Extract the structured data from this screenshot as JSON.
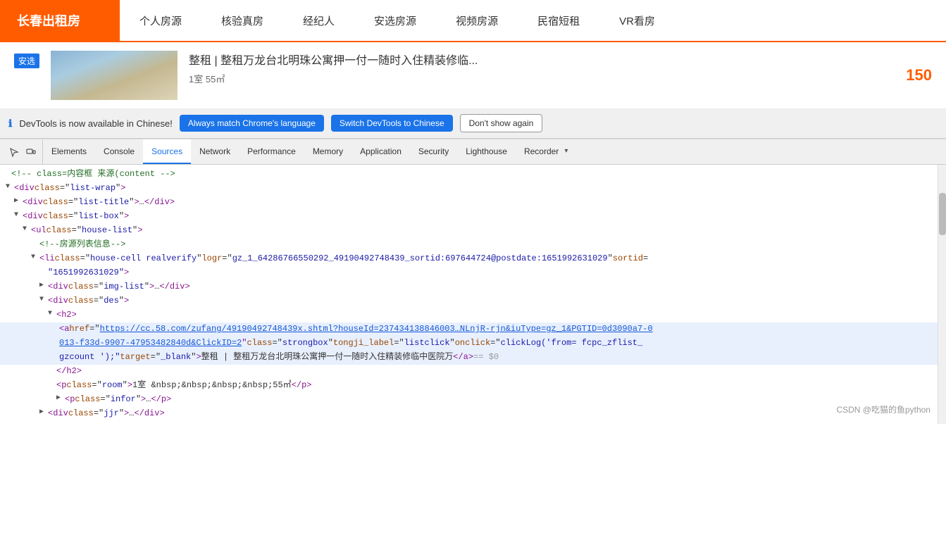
{
  "site": {
    "logo": "长春出租房",
    "nav": [
      "个人房源",
      "核验真房",
      "经纪人",
      "安选房源",
      "视频房源",
      "民宿短租",
      "VR看房"
    ]
  },
  "listing": {
    "badge": "安选",
    "title": "整租 | 整租万龙台北明珠公寓押一付一随时入住精装修临...",
    "meta": "1室  55㎡",
    "price": "150"
  },
  "devtools_notify": {
    "icon": "ℹ",
    "text": "DevTools is now available in Chinese!",
    "btn1": "Always match Chrome's language",
    "btn2": "Switch DevTools to Chinese",
    "btn3": "Don't show again"
  },
  "devtools_tabs": {
    "icons": [
      "cursor",
      "device"
    ],
    "tabs": [
      "Elements",
      "Console",
      "Sources",
      "Network",
      "Performance",
      "Memory",
      "Application",
      "Security",
      "Lighthouse",
      "Recorder"
    ]
  },
  "code": {
    "lines": [
      {
        "indent": 0,
        "content": "<!-- class=内容框  来源(content -->",
        "type": "comment"
      },
      {
        "indent": 0,
        "expanded": true,
        "tag_open": "<div class=\"list-wrap\">",
        "type": "tag"
      },
      {
        "indent": 1,
        "expanded": false,
        "tag_open": "<div class=\"list-title\">…</div>",
        "type": "tag"
      },
      {
        "indent": 1,
        "expanded": true,
        "tag_open": "<div class=\"list-box\">",
        "type": "tag"
      },
      {
        "indent": 2,
        "expanded": true,
        "tag_open": "<ul class=\"house-list\">",
        "type": "tag"
      },
      {
        "indent": 3,
        "content": "<!--房源列表信息-->",
        "type": "comment"
      },
      {
        "indent": 2,
        "expanded": true,
        "tag_open": "<li class=\"house-cell realverify\" logr=\"gz_1_64286766550292_49190492748439_sortid:697644724@postdate:1651992631029\" sortid=",
        "second_line": "\"1651992631029\">",
        "type": "tag_long"
      },
      {
        "indent": 3,
        "expanded": false,
        "tag_open": "<div class=\"img-list\">…</div>",
        "type": "tag"
      },
      {
        "indent": 3,
        "expanded": true,
        "tag_open": "<div class=\"des\">",
        "type": "tag"
      },
      {
        "indent": 4,
        "expanded": true,
        "tag_open": "<h2>",
        "type": "tag"
      },
      {
        "indent": 5,
        "type": "link_line",
        "link": "https://cc.58.com/zufang/49190492748439x.shtml?houseId=237434138846003…NLnjR-rjn&iuType=gz_1&PGTID=0d3090a7-0013-f33d-9907-47953482840d&ClickID=2",
        "class_attr": "class=\"strongbox\"",
        "tongji": "tongji_label=\"listclick\"",
        "onclick": "onclick=\"clickLog('from= fcpc_zflist_gzcount ');\"",
        "target": "target=\"_blank\"",
        "text": "整租 | 整租万龙台北明珠公寓押一付一随时入住精装修临中医院万",
        "end": "</a> == $0",
        "highlighted": true
      },
      {
        "indent": 4,
        "content": "</h2>",
        "type": "close_tag"
      },
      {
        "indent": 4,
        "content": "<p class=\"room\">1室 &nbsp;&nbsp;&nbsp;&nbsp;55㎡ </p>",
        "type": "tag"
      },
      {
        "indent": 4,
        "expanded": false,
        "tag_open": "<p class=\"infor\">…</p>",
        "type": "tag"
      },
      {
        "indent": 3,
        "expanded": false,
        "tag_open": "<div class=\"jjr\">…</div>",
        "type": "tag"
      }
    ]
  },
  "watermark": "CSDN @吃猫的鱼python"
}
